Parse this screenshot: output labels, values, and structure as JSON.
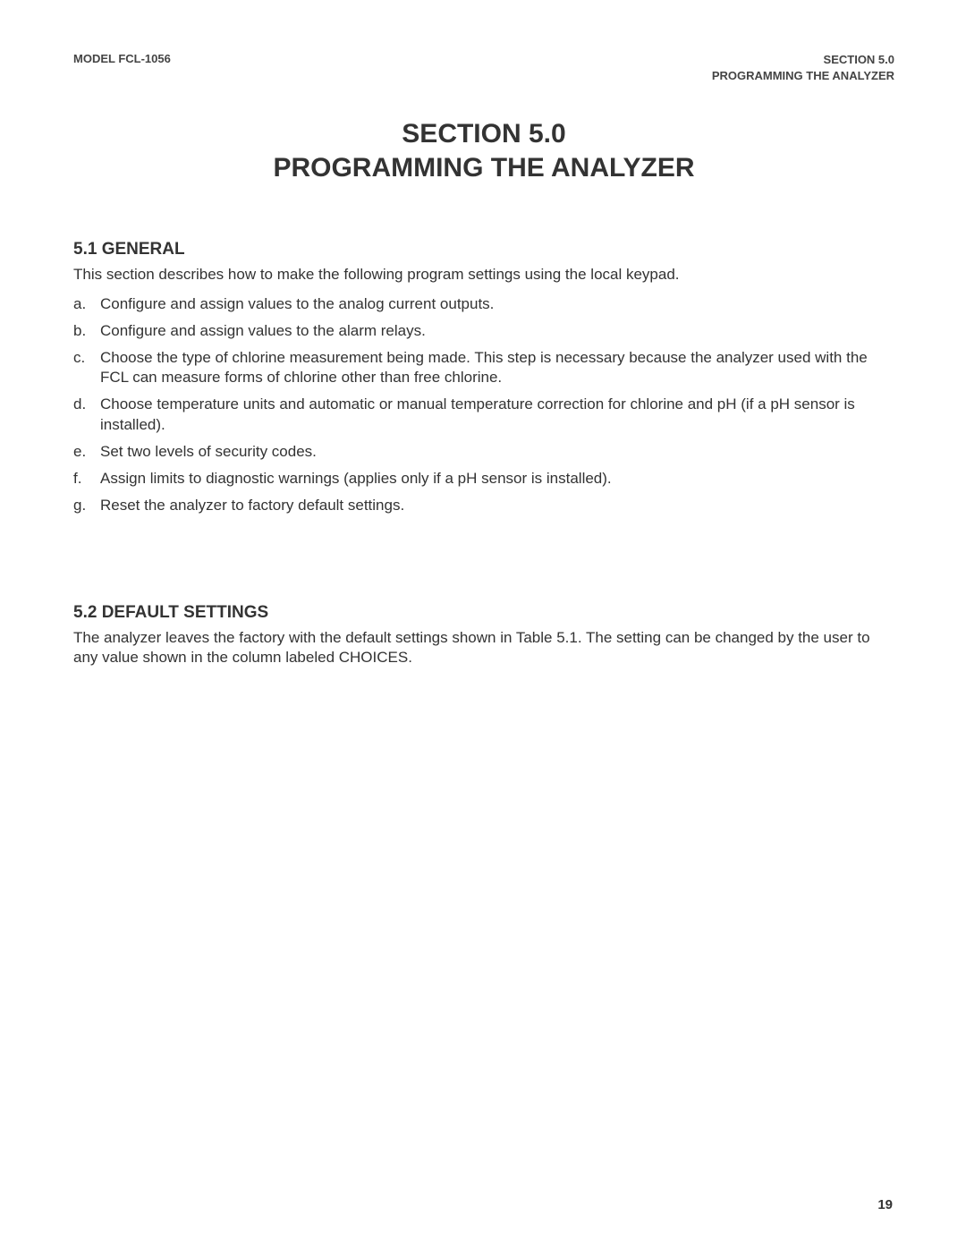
{
  "header": {
    "left": "MODEL FCL-1056",
    "right_line1": "SECTION 5.0",
    "right_line2": "PROGRAMMING THE ANALYZER"
  },
  "title": {
    "line1": "SECTION 5.0",
    "line2": "PROGRAMMING THE ANALYZER"
  },
  "section_5_1": {
    "heading": "5.1 GENERAL",
    "intro": "This section describes how to make the following program settings using the local keypad.",
    "items": [
      {
        "marker": "a.",
        "text": "Configure and assign values to the analog current outputs."
      },
      {
        "marker": "b.",
        "text": "Configure and assign values to the alarm relays."
      },
      {
        "marker": "c.",
        "text": "Choose the type of chlorine measurement being made. This step is necessary because the analyzer used with the FCL can measure forms of chlorine other than free chlorine."
      },
      {
        "marker": "d.",
        "text": "Choose temperature units and automatic or manual temperature correction for chlorine and pH (if a pH sensor is installed)."
      },
      {
        "marker": "e.",
        "text": "Set two levels of security codes."
      },
      {
        "marker": "f.",
        "text": "Assign limits to diagnostic warnings (applies only if a pH sensor is installed)."
      },
      {
        "marker": "g.",
        "text": "Reset the analyzer to factory default settings."
      }
    ]
  },
  "section_5_2": {
    "heading": "5.2   DEFAULT SETTINGS",
    "body": "The analyzer leaves the factory with the default settings shown in Table 5.1. The setting can be changed by the user to any value shown in the column labeled CHOICES."
  },
  "page_number": "19"
}
